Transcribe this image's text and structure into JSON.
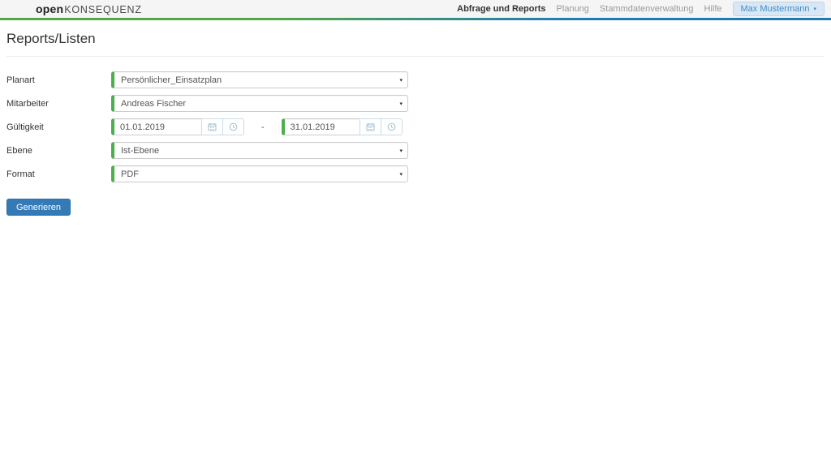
{
  "header": {
    "logo": {
      "part1": "open",
      "part2": "KONSEQUENZ"
    },
    "nav": [
      {
        "label": "Abfrage und Reports",
        "active": true
      },
      {
        "label": "Planung",
        "active": false
      },
      {
        "label": "Stammdatenverwaltung",
        "active": false
      },
      {
        "label": "Hilfe",
        "active": false
      }
    ],
    "user": {
      "label": "Max Mustermann"
    }
  },
  "page": {
    "title": "Reports/Listen"
  },
  "form": {
    "fields": {
      "planart": {
        "label": "Planart",
        "value": "Persönlicher_Einsatzplan"
      },
      "mitarbeiter": {
        "label": "Mitarbeiter",
        "value": "Andreas Fischer"
      },
      "gueltigkeit": {
        "label": "Gültigkeit",
        "from": "01.01.2019",
        "to": "31.01.2019",
        "separator": "-"
      },
      "ebene": {
        "label": "Ebene",
        "value": "Ist-Ebene"
      },
      "format": {
        "label": "Format",
        "value": "PDF"
      }
    },
    "submit_label": "Generieren"
  },
  "icons": {
    "caret_down": "▾"
  },
  "colors": {
    "accent_green": "#4cae4c",
    "accent_blue": "#1d7ab8",
    "header_bg": "#f5f5f5",
    "button_blue": "#337ab7",
    "user_button_bg": "#d9e7f4",
    "user_button_text": "#3e8ec9"
  }
}
